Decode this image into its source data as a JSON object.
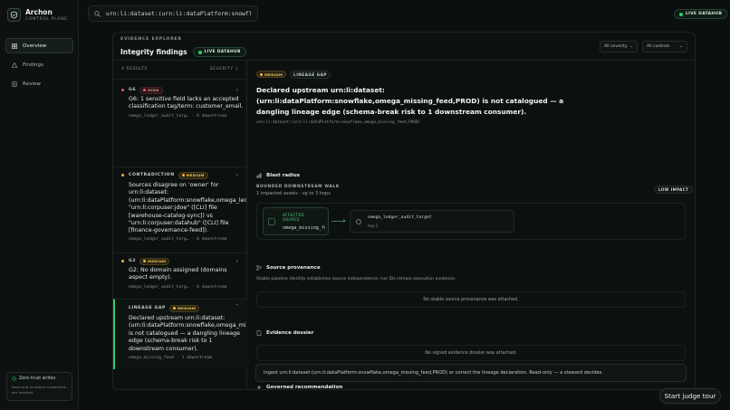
{
  "brand": {
    "name": "Archon",
    "sub": "CONTROL PLANE"
  },
  "nav": [
    {
      "label": "Overview",
      "icon": "grid-icon"
    },
    {
      "label": "Findings",
      "icon": "warning-icon"
    },
    {
      "label": "Review",
      "icon": "clipboard-icon"
    }
  ],
  "zero_trust": {
    "title": "Zero-trust writes",
    "text": "Read and mutation credentials are isolated."
  },
  "search": {
    "value": "urn:li:dataset:(urn:li:dataPlatform:snowflake,om"
  },
  "top_badge": "LIVE DATAHUB",
  "panel": {
    "eyebrow": "EVIDENCE EXPLORER",
    "title": "Integrity findings",
    "live_badge": "LIVE DATAHUB",
    "filter_severity": "All severity",
    "filter_controls": "All controls"
  },
  "list": {
    "results": "4 RESULTS",
    "sort": "SEVERITY ↓",
    "items": [
      {
        "kind": "G6",
        "severity": "HIGH",
        "body": "G6: 1 sensitive field lacks an accepted classification tag/term: customer_email.",
        "dataset": "omega_ledger_audit_targ…",
        "downstream": "0 downstream"
      },
      {
        "kind": "CONTRADICTION",
        "severity": "MEDIUM",
        "body": "Sources disagree on 'owner' for urn:li:dataset:(urn:li:dataPlatform:snowflake,omega_ledger_au… \"urn:li:corpuser:jdoe\" ([CLI] file [warehouse-catalog-sync]) vs \"urn:li:corpuser:datahub\" ([CLI] file [finance-governance-feed]).",
        "dataset": "omega_ledger_audit_targ…",
        "downstream": "0 downstream"
      },
      {
        "kind": "G2",
        "severity": "MEDIUM",
        "body": "G2: No domain assigned (domains aspect empty).",
        "dataset": "omega_ledger_audit_targ…",
        "downstream": "0 downstream"
      },
      {
        "kind": "LINEAGE GAP",
        "severity": "MEDIUM",
        "body": "Declared upstream urn:li:dataset:(urn:li:dataPlatform:snowflake,omega_missing_feed,PROD) is not catalogued — a dangling lineage edge (schema-break risk to 1 downstream consumer).",
        "dataset": "omega_missing_feed",
        "downstream": "1 downstream"
      }
    ]
  },
  "detail": {
    "severity": "MEDIUM",
    "kind": "LINEAGE GAP",
    "title": "Declared upstream urn:li:dataset:(urn:li:dataPlatform:snowflake,omega_missing_feed,PROD) is not catalogued — a dangling lineage edge (schema-break risk to 1 downstream consumer).",
    "urn": "urn:li:dataset:(urn:li:dataPlatform:snowflake,omega_missing_feed,PROD)",
    "blast": {
      "heading": "Blast radius",
      "walk_label": "BOUNDED DOWNSTREAM WALK",
      "walk_sub": "1 impacted assets · up to 3 hops",
      "impact": "LOW IMPACT",
      "source_label": "AFFECTED SOURCE",
      "source_name": "omega_missing_feed",
      "target_name": "omega_ledger_audit_target",
      "target_hop": "hop 1"
    },
    "provenance": {
      "heading": "Source provenance",
      "sub": "Stable pipeline identity establishes source independence; run IDs remain execution evidence.",
      "empty": "No stable source provenance was attached."
    },
    "dossier": {
      "heading": "Evidence dossier",
      "empty": "No signed evidence dossier was attached."
    },
    "recommendation": {
      "heading": "Governed recommendation",
      "text": "Ingest urn:li:dataset:(urn:li:dataPlatform:snowflake,omega_missing_feed,PROD) or correct the lineage declaration. Read-only — a steward decides."
    }
  },
  "tour_button": "Start judge tour",
  "colors": {
    "accent_green": "#2fcf6a",
    "high": "#f05a5a",
    "medium": "#f1b73a",
    "background": "#0b0f0d"
  }
}
